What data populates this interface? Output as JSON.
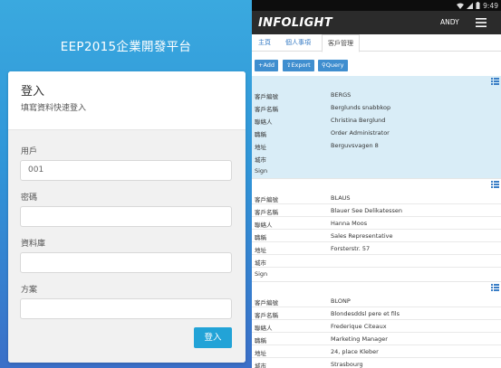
{
  "login": {
    "app_title": "EEP2015企業開發平台",
    "card_title": "登入",
    "card_subtitle": "填寫資料快速登入",
    "fields": [
      {
        "label": "用戶",
        "value": "001"
      },
      {
        "label": "密碼",
        "value": ""
      },
      {
        "label": "資料庫",
        "value": ""
      },
      {
        "label": "方案",
        "value": ""
      }
    ],
    "submit_label": "登入",
    "colors": {
      "gradient_top": "#3aa9df",
      "gradient_bottom": "#3b6fc8",
      "button": "#22a3d7"
    }
  },
  "list_app": {
    "status_time": "9:49",
    "logo_text": "INFOLIGHT",
    "user": "ANDY",
    "tabs": [
      {
        "label": "主頁",
        "active": false
      },
      {
        "label": "個人事項",
        "active": false
      },
      {
        "label": "客戶管理",
        "active": true
      }
    ],
    "toolbar": [
      {
        "label": "Add",
        "icon": "plus-icon"
      },
      {
        "label": "Export",
        "icon": "export-icon"
      },
      {
        "label": "Query",
        "icon": "search-icon"
      }
    ],
    "field_labels": [
      "客戶編號",
      "客戶名稱",
      "聯絡人",
      "職稱",
      "地址",
      "城市",
      "Sign"
    ],
    "records": [
      {
        "selected": true,
        "values": [
          "BERGS",
          "Berglunds snabbkop",
          "Christina Berglund",
          "Order Administrator",
          "Berguvsvagen 8",
          "",
          ""
        ]
      },
      {
        "selected": false,
        "values": [
          "BLAUS",
          "Blauer See Delikatessen",
          "Hanna Moos",
          "Sales Representative",
          "Forsterstr. 57",
          "",
          ""
        ]
      },
      {
        "selected": false,
        "values": [
          "BLONP",
          "Blondesddsl pere et fils",
          "Frederique Citeaux",
          "Marketing Manager",
          "24, place Kleber",
          "Strasbourg",
          ""
        ]
      }
    ],
    "colors": {
      "app_bar": "#2b2b2b",
      "accent": "#3f8ecf",
      "selected_row": "#d9edf7"
    }
  }
}
